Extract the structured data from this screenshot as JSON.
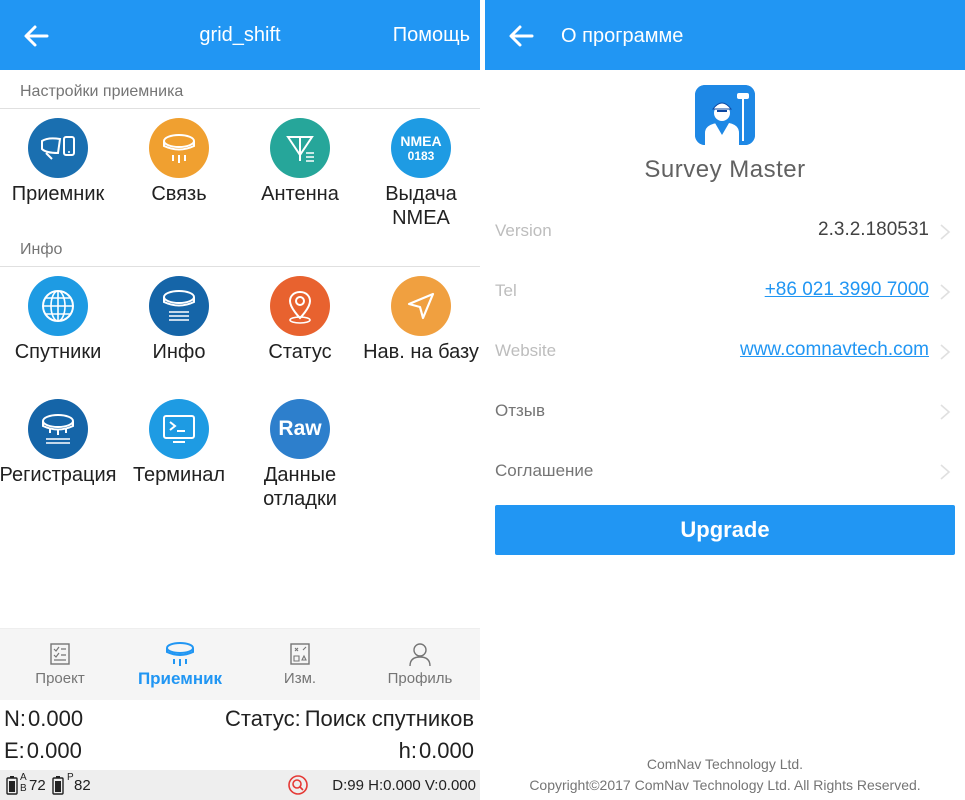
{
  "left": {
    "header": {
      "title": "grid_shift",
      "help_label": "Помощь"
    },
    "section_receiver": "Настройки приемника",
    "receiver_tiles": [
      {
        "label": "Приемник",
        "icon": "receiver-devices-icon",
        "color": "#1a6fb0"
      },
      {
        "label": "Связь",
        "icon": "antenna-link-icon",
        "color": "#f0a030"
      },
      {
        "label": "Антенна",
        "icon": "antenna-icon",
        "color": "#26a69a"
      },
      {
        "label": "Выдача NMEA",
        "icon": "nmea-icon",
        "color": "#1e9be3",
        "badge_top": "NMEA",
        "badge_bottom": "0183"
      }
    ],
    "section_info": "Инфо",
    "info_tiles": [
      {
        "label": "Спутники",
        "icon": "globe-icon",
        "color": "#1e9be3"
      },
      {
        "label": "Инфо",
        "icon": "receiver-info-icon",
        "color": "#1565a8"
      },
      {
        "label": "Статус",
        "icon": "location-pin-icon",
        "color": "#e8622f"
      },
      {
        "label": "Нав. на базу",
        "icon": "navigation-arrow-icon",
        "color": "#f0a040"
      },
      {
        "label": "Регистрация",
        "icon": "receiver-log-icon",
        "color": "#1565a8"
      },
      {
        "label": "Терминал",
        "icon": "terminal-icon",
        "color": "#1e9be3"
      },
      {
        "label": "Данные отладки",
        "icon": "raw-icon",
        "color": "#2d7fcc",
        "badge": "Raw"
      }
    ],
    "bottom_nav": [
      {
        "label": "Проект",
        "icon": "project-icon",
        "active": false
      },
      {
        "label": "Приемник",
        "icon": "receiver-nav-icon",
        "active": true
      },
      {
        "label": "Изм.",
        "icon": "measure-icon",
        "active": false
      },
      {
        "label": "Профиль",
        "icon": "profile-icon",
        "active": false
      }
    ],
    "coords": {
      "n_label": "N:",
      "n_value": "0.000",
      "status_label": "Статус:",
      "status_value": "Поиск спутников",
      "e_label": "E:",
      "e_value": "0.000",
      "h_label": "h:",
      "h_value": "0.000"
    },
    "statusbar": {
      "battery_a_super": "A",
      "battery_a_sub": "B",
      "battery_a_value": "72",
      "battery_p_super": "P",
      "battery_p_value": "82",
      "dop": "D:99 H:0.000 V:0.000"
    }
  },
  "right": {
    "header": {
      "title": "О программе"
    },
    "app_name": "Survey Master",
    "rows": [
      {
        "key": "Version",
        "value": "2.3.2.180531",
        "link": false,
        "dark": false
      },
      {
        "key": "Tel",
        "value": "+86 021 3990 7000",
        "link": true,
        "dark": false
      },
      {
        "key": "Website",
        "value": "www.comnavtech.com",
        "link": true,
        "dark": false
      },
      {
        "key": "Отзыв",
        "value": "",
        "link": false,
        "dark": true
      },
      {
        "key": "Соглашение",
        "value": "",
        "link": false,
        "dark": true
      }
    ],
    "upgrade_label": "Upgrade",
    "footer_company": "ComNav Technology Ltd.",
    "footer_copyright": "Copyright©2017 ComNav Technology Ltd. All Rights Reserved."
  },
  "colors": {
    "primary": "#2196f3",
    "active_nav": "#2196f3",
    "status_icon": "#e53935"
  }
}
